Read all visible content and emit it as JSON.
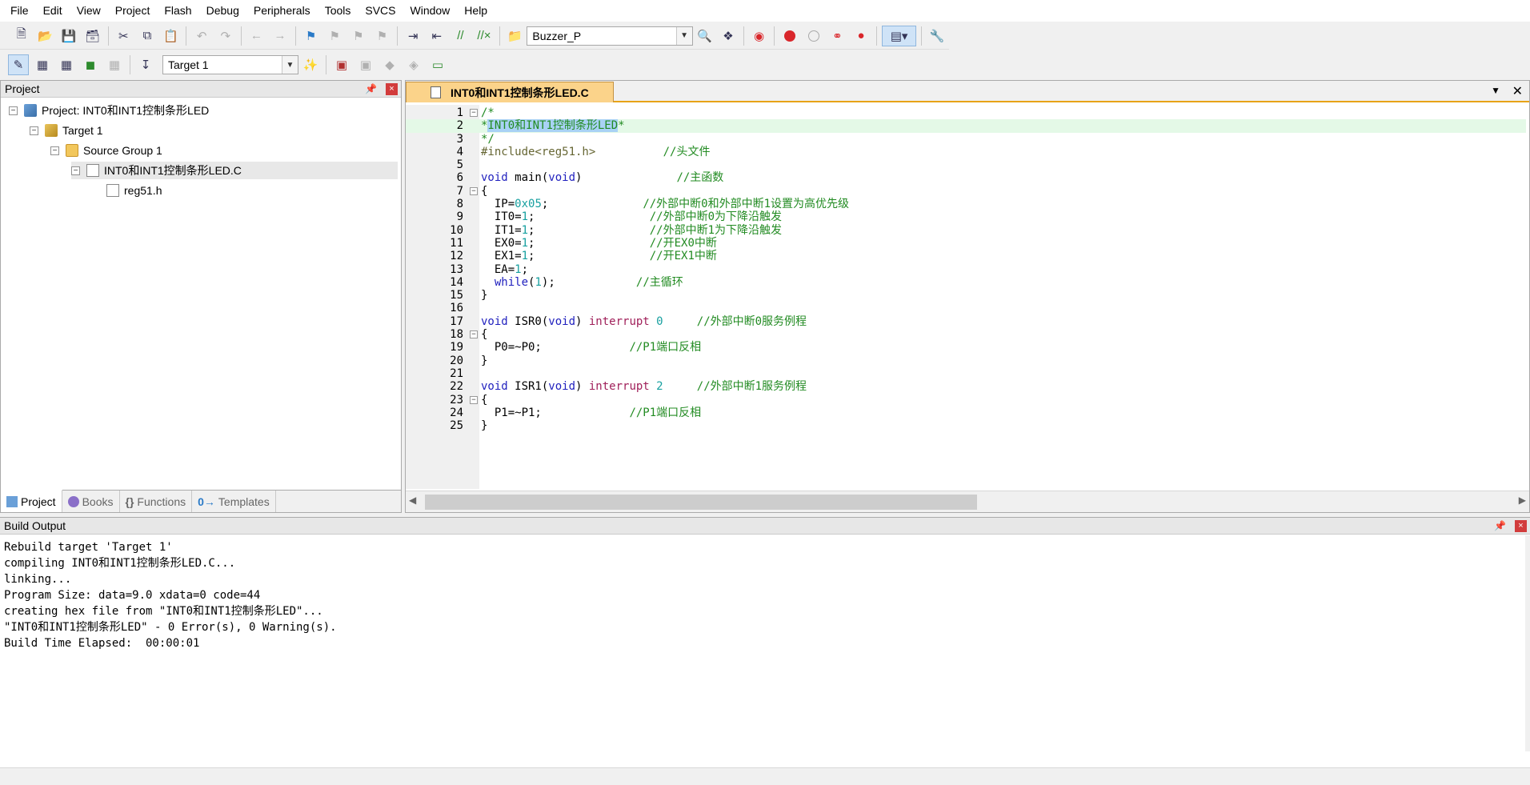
{
  "menu": [
    "File",
    "Edit",
    "View",
    "Project",
    "Flash",
    "Debug",
    "Peripherals",
    "Tools",
    "SVCS",
    "Window",
    "Help"
  ],
  "toolbar": {
    "find_combo_value": "Buzzer_P",
    "target_combo_value": "Target 1"
  },
  "project_panel": {
    "title": "Project",
    "tree": {
      "project": "Project: INT0和INT1控制条形LED",
      "target": "Target 1",
      "group": "Source Group 1",
      "file": "INT0和INT1控制条形LED.C",
      "header": "reg51.h"
    },
    "tabs": [
      "Project",
      "Books",
      "Functions",
      "Templates"
    ]
  },
  "editor": {
    "tab_label": "INT0和INT1控制条形LED.C",
    "lines": [
      {
        "n": "1",
        "parts": [
          {
            "c": "c-cm",
            "t": "/*"
          }
        ]
      },
      {
        "n": "2",
        "parts": [
          {
            "c": "c-cm",
            "t": "*"
          },
          {
            "c": "c-cm c-sel",
            "t": "INT0和INT1控制条形LED"
          },
          {
            "c": "c-cm",
            "t": "*"
          }
        ]
      },
      {
        "n": "3",
        "parts": [
          {
            "c": "c-cm",
            "t": "*/"
          }
        ]
      },
      {
        "n": "4",
        "parts": [
          {
            "c": "c-pp",
            "t": "#include<reg51.h>"
          },
          {
            "c": "",
            "t": "          "
          },
          {
            "c": "c-cm",
            "t": "//头文件"
          }
        ]
      },
      {
        "n": "5",
        "parts": []
      },
      {
        "n": "6",
        "parts": [
          {
            "c": "c-kw",
            "t": "void"
          },
          {
            "c": "",
            "t": " main("
          },
          {
            "c": "c-kw",
            "t": "void"
          },
          {
            "c": "",
            "t": ")              "
          },
          {
            "c": "c-cm",
            "t": "//主函数"
          }
        ]
      },
      {
        "n": "7",
        "parts": [
          {
            "c": "",
            "t": "{"
          }
        ]
      },
      {
        "n": "8",
        "parts": [
          {
            "c": "",
            "t": "  IP="
          },
          {
            "c": "c-num",
            "t": "0x05"
          },
          {
            "c": "",
            "t": ";              "
          },
          {
            "c": "c-cm",
            "t": "//外部中断0和外部中断1设置为高优先级"
          }
        ]
      },
      {
        "n": "9",
        "parts": [
          {
            "c": "",
            "t": "  IT0="
          },
          {
            "c": "c-num",
            "t": "1"
          },
          {
            "c": "",
            "t": ";                 "
          },
          {
            "c": "c-cm",
            "t": "//外部中断0为下降沿触发"
          }
        ]
      },
      {
        "n": "10",
        "parts": [
          {
            "c": "",
            "t": "  IT1="
          },
          {
            "c": "c-num",
            "t": "1"
          },
          {
            "c": "",
            "t": ";                 "
          },
          {
            "c": "c-cm",
            "t": "//外部中断1为下降沿触发"
          }
        ]
      },
      {
        "n": "11",
        "parts": [
          {
            "c": "",
            "t": "  EX0="
          },
          {
            "c": "c-num",
            "t": "1"
          },
          {
            "c": "",
            "t": ";                 "
          },
          {
            "c": "c-cm",
            "t": "//开EX0中断"
          }
        ]
      },
      {
        "n": "12",
        "parts": [
          {
            "c": "",
            "t": "  EX1="
          },
          {
            "c": "c-num",
            "t": "1"
          },
          {
            "c": "",
            "t": ";                 "
          },
          {
            "c": "c-cm",
            "t": "//开EX1中断"
          }
        ]
      },
      {
        "n": "13",
        "parts": [
          {
            "c": "",
            "t": "  EA="
          },
          {
            "c": "c-num",
            "t": "1"
          },
          {
            "c": "",
            "t": ";"
          }
        ]
      },
      {
        "n": "14",
        "parts": [
          {
            "c": "",
            "t": "  "
          },
          {
            "c": "c-kw",
            "t": "while"
          },
          {
            "c": "",
            "t": "("
          },
          {
            "c": "c-num",
            "t": "1"
          },
          {
            "c": "",
            "t": ");            "
          },
          {
            "c": "c-cm",
            "t": "//主循环"
          }
        ]
      },
      {
        "n": "15",
        "parts": [
          {
            "c": "",
            "t": "}"
          }
        ]
      },
      {
        "n": "16",
        "parts": []
      },
      {
        "n": "17",
        "parts": [
          {
            "c": "c-kw",
            "t": "void"
          },
          {
            "c": "",
            "t": " ISR0("
          },
          {
            "c": "c-kw",
            "t": "void"
          },
          {
            "c": "",
            "t": ") "
          },
          {
            "c": "c-int",
            "t": "interrupt"
          },
          {
            "c": "",
            "t": " "
          },
          {
            "c": "c-num",
            "t": "0"
          },
          {
            "c": "",
            "t": "     "
          },
          {
            "c": "c-cm",
            "t": "//外部中断0服务例程"
          }
        ]
      },
      {
        "n": "18",
        "parts": [
          {
            "c": "",
            "t": "{"
          }
        ]
      },
      {
        "n": "19",
        "parts": [
          {
            "c": "",
            "t": "  P0=~P0;             "
          },
          {
            "c": "c-cm",
            "t": "//P1端口反相"
          }
        ]
      },
      {
        "n": "20",
        "parts": [
          {
            "c": "",
            "t": "}"
          }
        ]
      },
      {
        "n": "21",
        "parts": []
      },
      {
        "n": "22",
        "parts": [
          {
            "c": "c-kw",
            "t": "void"
          },
          {
            "c": "",
            "t": " ISR1("
          },
          {
            "c": "c-kw",
            "t": "void"
          },
          {
            "c": "",
            "t": ") "
          },
          {
            "c": "c-int",
            "t": "interrupt"
          },
          {
            "c": "",
            "t": " "
          },
          {
            "c": "c-num",
            "t": "2"
          },
          {
            "c": "",
            "t": "     "
          },
          {
            "c": "c-cm",
            "t": "//外部中断1服务例程"
          }
        ]
      },
      {
        "n": "23",
        "parts": [
          {
            "c": "",
            "t": "{"
          }
        ]
      },
      {
        "n": "24",
        "parts": [
          {
            "c": "",
            "t": "  P1=~P1;             "
          },
          {
            "c": "c-cm",
            "t": "//P1端口反相"
          }
        ]
      },
      {
        "n": "25",
        "parts": [
          {
            "c": "",
            "t": "}"
          }
        ]
      }
    ]
  },
  "build_output": {
    "title": "Build Output",
    "lines": [
      "Rebuild target 'Target 1'",
      "compiling INT0和INT1控制条形LED.C...",
      "linking...",
      "Program Size: data=9.0 xdata=0 code=44",
      "creating hex file from \"INT0和INT1控制条形LED\"...",
      "\"INT0和INT1控制条形LED\" - 0 Error(s), 0 Warning(s).",
      "Build Time Elapsed:  00:00:01"
    ]
  },
  "colors": {
    "tab_active": "#fbd38a",
    "tab_border": "#e8a317",
    "highlight_line": "#e4f9e7",
    "selection": "#a9d2f5"
  },
  "icons": [
    "new-file-icon",
    "open-icon",
    "save-icon",
    "save-all-icon",
    "cut-icon",
    "copy-icon",
    "paste-icon",
    "undo-icon",
    "redo-icon",
    "back-icon",
    "forward-icon",
    "bookmark-icon",
    "indent-icon",
    "unindent-icon",
    "comment-icon",
    "uncomment-icon",
    "find-in-files-icon",
    "debug-start-icon",
    "breakpoint-icon",
    "wrench-icon",
    "build-icon",
    "rebuild-icon",
    "download-icon",
    "options-icon"
  ]
}
